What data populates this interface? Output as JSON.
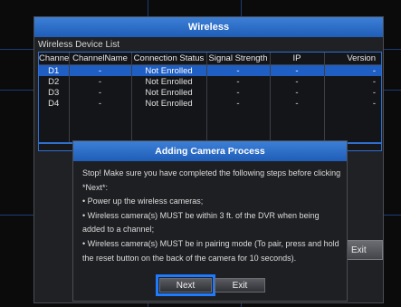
{
  "window": {
    "title": "Wireless"
  },
  "device_list": {
    "label": "Wireless Device List",
    "columns": [
      "Channel",
      "ChannelName",
      "Connection Status",
      "Signal Strength",
      "IP",
      "Version"
    ],
    "rows": [
      [
        "D1",
        "-",
        "Not Enrolled",
        "-",
        "-",
        "-"
      ],
      [
        "D2",
        "-",
        "Not Enrolled",
        "-",
        "-",
        "-"
      ],
      [
        "D3",
        "-",
        "Not Enrolled",
        "-",
        "-",
        "-"
      ],
      [
        "D4",
        "-",
        "Not Enrolled",
        "-",
        "-",
        "-"
      ]
    ],
    "scroll_thumb": "|||"
  },
  "background_exit_label": "Exit",
  "dialog": {
    "title": "Adding Camera Process",
    "intro": "Stop! Make sure you have completed the following steps before clicking *Next*:",
    "steps": [
      "• Power up the wireless cameras;",
      "• Wireless camera(s) MUST be within 3 ft. of the DVR when being added to a channel;",
      "• Wireless camera(s) MUST be in pairing mode (To pair, press and hold the reset button on the back of the camera for 10 seconds)."
    ],
    "next_label": "Next",
    "exit_label": "Exit"
  },
  "colors": {
    "accent": "#1f5fc4",
    "highlight": "#1e7bff"
  }
}
